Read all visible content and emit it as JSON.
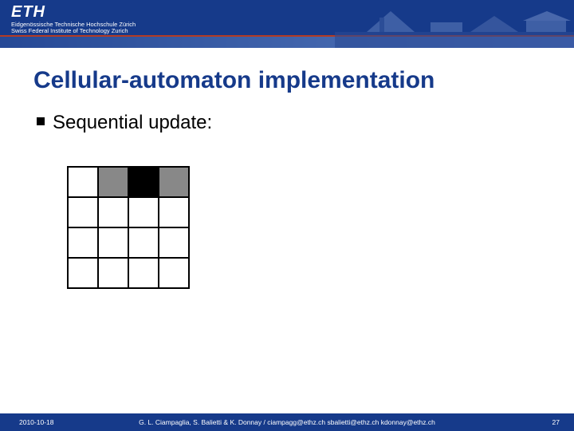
{
  "header": {
    "logo_text": "ETH",
    "subtext1": "Eidgenössische Technische Hochschule Zürich",
    "subtext2": "Swiss Federal Institute of Technology Zurich"
  },
  "title": "Cellular-automaton implementation",
  "bullet": {
    "text": "Sequential update:"
  },
  "grid": {
    "rows": 4,
    "cols": 4,
    "cells": [
      [
        "w",
        "g",
        "k",
        "g"
      ],
      [
        "w",
        "w",
        "w",
        "w"
      ],
      [
        "w",
        "w",
        "w",
        "w"
      ],
      [
        "w",
        "w",
        "w",
        "w"
      ]
    ],
    "legend": {
      "w": "white",
      "g": "gray",
      "k": "black"
    }
  },
  "footer": {
    "date": "2010-10-18",
    "authors": "G. L. Ciampaglia, S. Balietti & K. Donnay /  ciampagg@ethz.ch  sbalietti@ethz.ch  kdonnay@ethz.ch",
    "page_number": "27"
  }
}
